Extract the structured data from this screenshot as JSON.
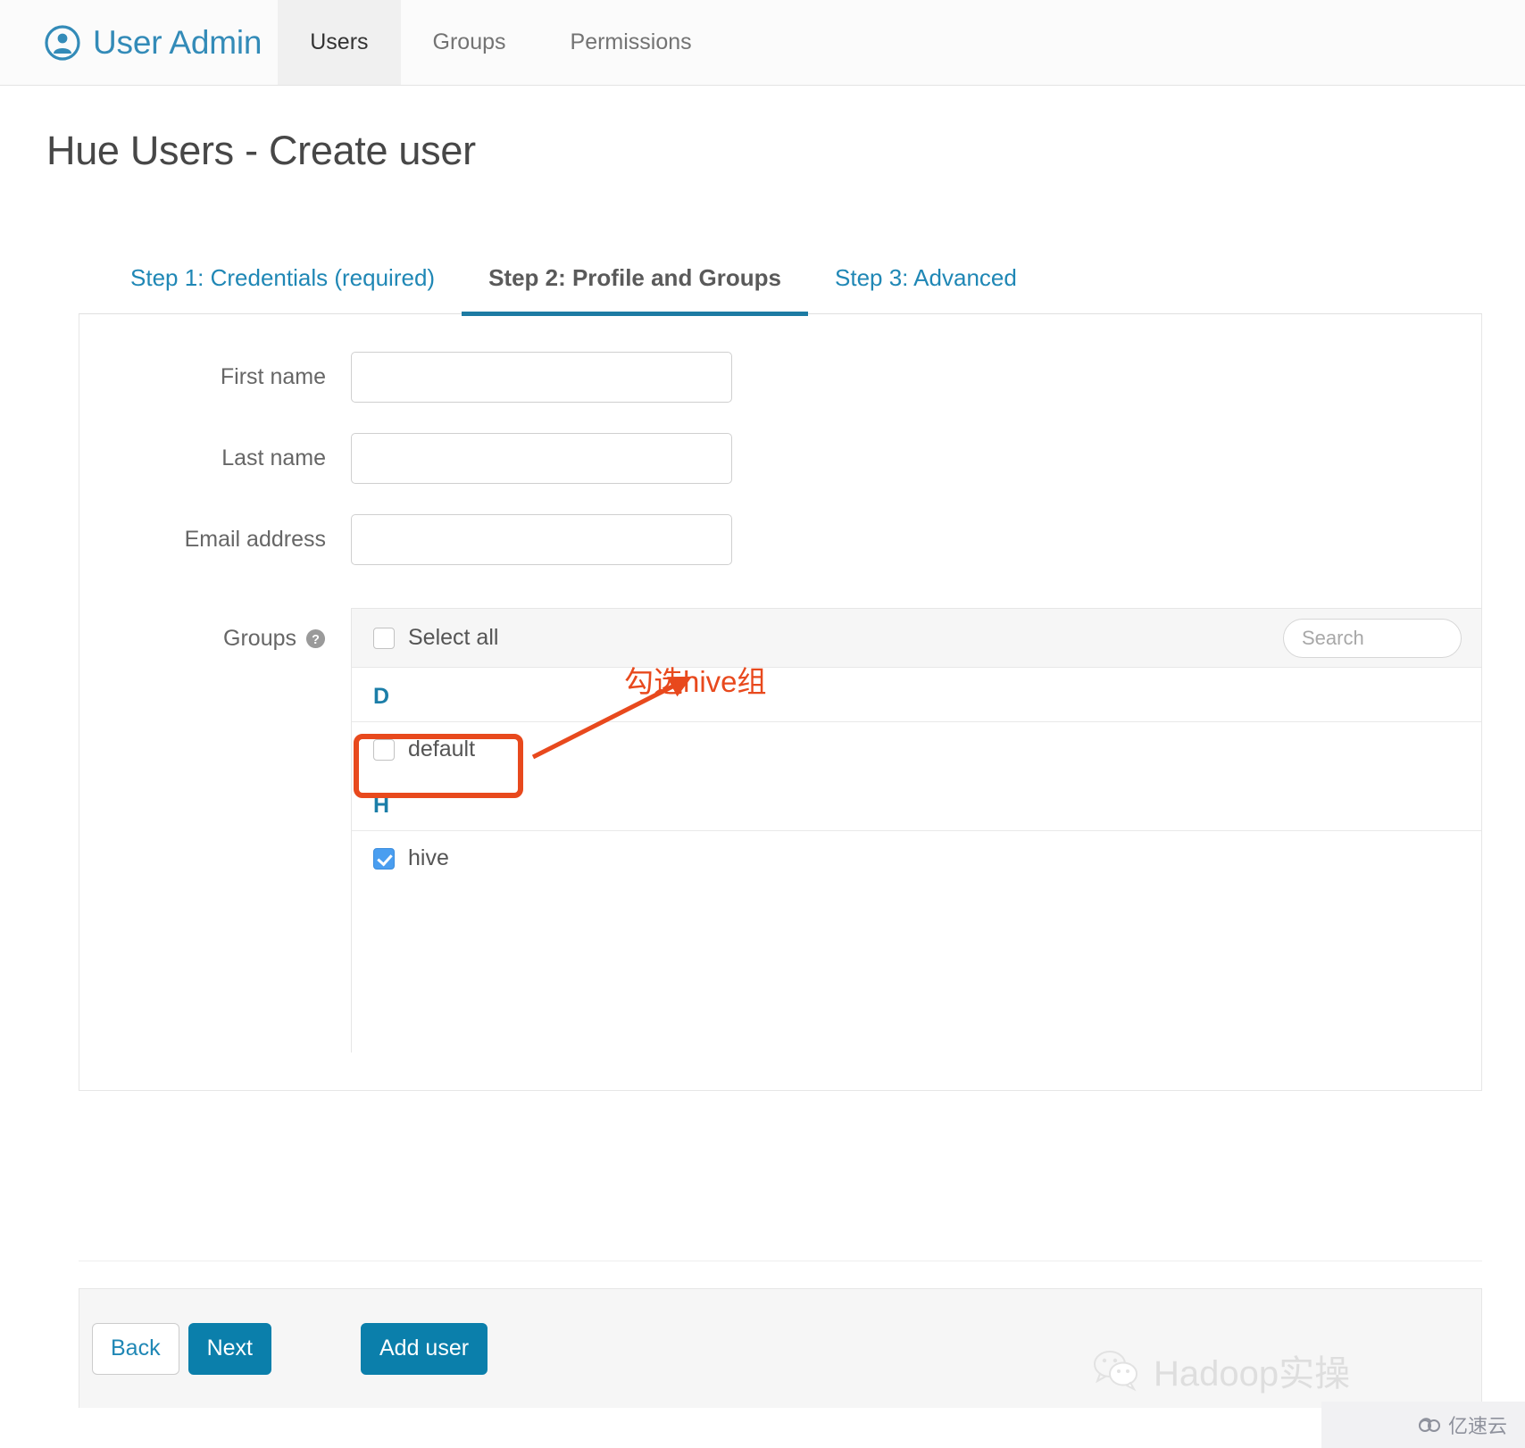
{
  "navbar": {
    "brand": "User Admin",
    "brand_icon": "user-circle-icon",
    "brand_color": "#338bb8",
    "tabs": [
      {
        "label": "Users",
        "active": true
      },
      {
        "label": "Groups",
        "active": false
      },
      {
        "label": "Permissions",
        "active": false
      }
    ]
  },
  "page": {
    "title": "Hue Users - Create user"
  },
  "steps": [
    {
      "label": "Step 1: Credentials (required)",
      "active": false
    },
    {
      "label": "Step 2: Profile and Groups",
      "active": true
    },
    {
      "label": "Step 3: Advanced",
      "active": false
    }
  ],
  "form": {
    "fields": [
      {
        "label": "First name",
        "value": "",
        "placeholder": ""
      },
      {
        "label": "Last name",
        "value": "",
        "placeholder": ""
      },
      {
        "label": "Email address",
        "value": "",
        "placeholder": ""
      }
    ],
    "groups": {
      "label": "Groups",
      "help_icon": "question-mark-circle-icon",
      "select_all_label": "Select all",
      "select_all_checked": false,
      "search_placeholder": "Search",
      "search_value": "",
      "sections": [
        {
          "letter": "D",
          "items": [
            {
              "name": "default",
              "checked": false
            }
          ]
        },
        {
          "letter": "H",
          "items": [
            {
              "name": "hive",
              "checked": true
            }
          ]
        }
      ]
    }
  },
  "annotation": {
    "text": "勾选hive组",
    "color": "#e8491d",
    "target": "hive-group-checkbox"
  },
  "footer": {
    "buttons": [
      {
        "label": "Back",
        "style": "default"
      },
      {
        "label": "Next",
        "style": "primary"
      },
      {
        "label": "Add user",
        "style": "primary"
      }
    ]
  },
  "watermarks": {
    "hadoop": "Hadoop实操",
    "hadoop_icon": "wechat-icon",
    "corner": "亿速云",
    "corner_icon": "cloud-icon"
  },
  "colors": {
    "accent": "#0b7fab",
    "link": "#1f87b5",
    "annotation": "#e8491d",
    "checkbox_checked": "#4a9ef0"
  }
}
